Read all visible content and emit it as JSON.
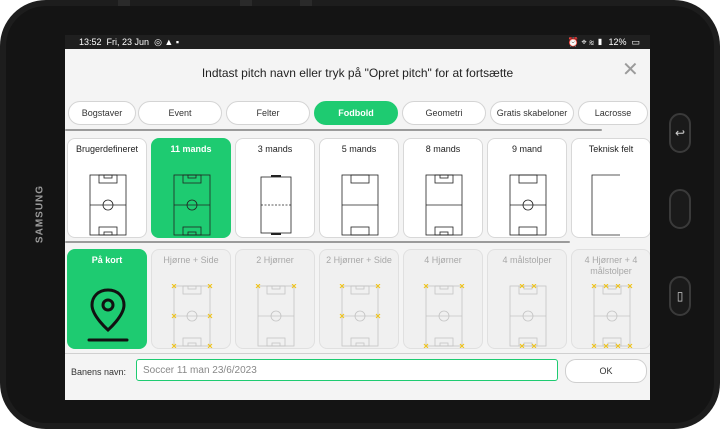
{
  "status_bar": {
    "time": "13:52",
    "date": "Fri, 23 Jun",
    "battery": "12%"
  },
  "dialog": {
    "title": "Indtast pitch navn eller tryk på \"Opret pitch\" for at fortsætte",
    "close_icon": "close-icon"
  },
  "tabs": [
    {
      "label": "Bogstaver"
    },
    {
      "label": "Event"
    },
    {
      "label": "Felter"
    },
    {
      "label": "Fodbold",
      "active": true
    },
    {
      "label": "Geometri"
    },
    {
      "label": "Gratis skabeloner"
    },
    {
      "label": "Lacrosse"
    }
  ],
  "templates": [
    {
      "label": "Brugerdefineret",
      "icon": "full-pitch"
    },
    {
      "label": "11 mands",
      "active": true,
      "icon": "full-pitch"
    },
    {
      "label": "3 mands",
      "icon": "small-pitch"
    },
    {
      "label": "5 mands",
      "icon": "five-pitch"
    },
    {
      "label": "8 mands",
      "icon": "eight-pitch"
    },
    {
      "label": "9 mand",
      "icon": "nine-pitch"
    },
    {
      "label": "Teknisk felt",
      "icon": "technical-area"
    }
  ],
  "markings": [
    {
      "label": "På kort",
      "active": true,
      "icon": "map-pin-icon"
    },
    {
      "label": "Hjørne + Side",
      "disabled": true,
      "icon": "pitch-markers"
    },
    {
      "label": "2 Hjørner",
      "disabled": true,
      "icon": "pitch-markers"
    },
    {
      "label": "2 Hjørner + Side",
      "disabled": true,
      "icon": "pitch-markers"
    },
    {
      "label": "4 Hjørner",
      "disabled": true,
      "icon": "pitch-markers"
    },
    {
      "label": "4 målstolper",
      "disabled": true,
      "icon": "pitch-markers"
    },
    {
      "label": "4 Hjørner + 4 målstolper",
      "disabled": true,
      "icon": "pitch-markers"
    }
  ],
  "footer": {
    "name_label": "Banens navn:",
    "name_value": "Soccer 11 man 23/6/2023",
    "ok_label": "OK"
  },
  "device": {
    "brand": "SAMSUNG"
  },
  "colors": {
    "accent": "#1ecb71",
    "marker": "#f0c419",
    "bezel": "#1d1d1d"
  }
}
